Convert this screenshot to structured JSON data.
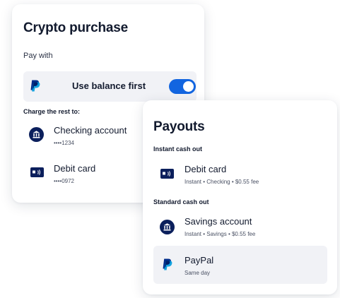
{
  "crypto": {
    "title": "Crypto purchase",
    "pay_with_label": "Pay with",
    "balance": {
      "label": "Use balance first",
      "toggle_on": true
    },
    "charge_rest_label": "Charge the rest to:",
    "methods": [
      {
        "icon": "bank-icon",
        "title": "Checking account",
        "sub": "••••1234"
      },
      {
        "icon": "debit-card-icon",
        "title": "Debit card",
        "sub": "••••0972"
      }
    ]
  },
  "payouts": {
    "title": "Payouts",
    "instant_label": "Instant cash out",
    "instant": [
      {
        "icon": "debit-card-icon",
        "title": "Debit card",
        "sub": "Instant • Checking •  $0.55 fee"
      }
    ],
    "standard_label": "Standard cash out",
    "standard": [
      {
        "icon": "bank-icon",
        "title": "Savings account",
        "sub": "Instant • Savings • $0.55 fee"
      },
      {
        "icon": "paypal-icon",
        "title": "PayPal",
        "sub": "Same day",
        "selected": true
      }
    ]
  },
  "colors": {
    "navy": "#0b1f5c",
    "toggle_blue": "#1265e0",
    "row_bg": "#f1f2f6",
    "paypal_dark": "#002c8a",
    "paypal_light": "#009cde"
  }
}
